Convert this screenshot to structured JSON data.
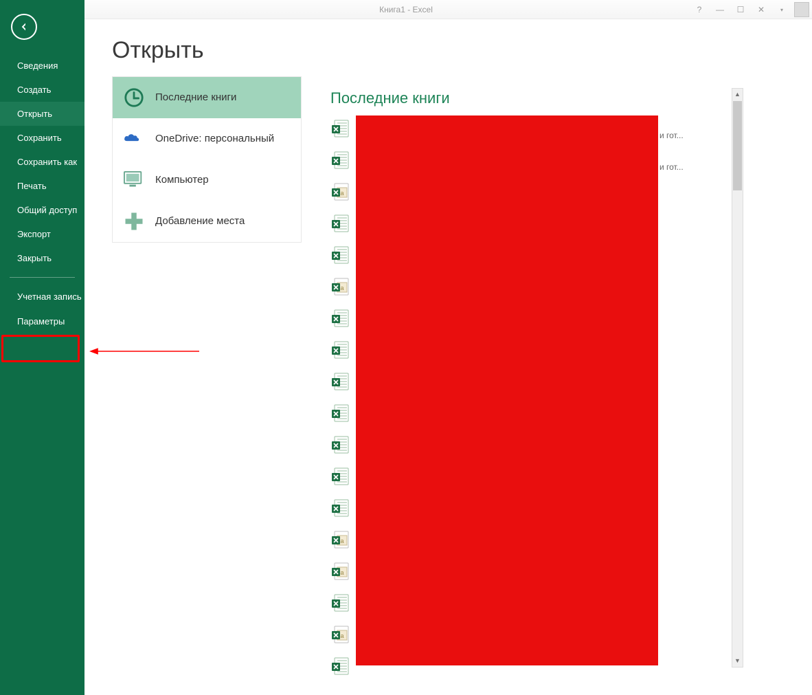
{
  "titlebar": {
    "title": "Книга1 - Excel"
  },
  "sidebar": {
    "items": [
      {
        "label": "Сведения"
      },
      {
        "label": "Создать"
      },
      {
        "label": "Открыть",
        "selected": true
      },
      {
        "label": "Сохранить"
      },
      {
        "label": "Сохранить как"
      },
      {
        "label": "Печать"
      },
      {
        "label": "Общий доступ"
      },
      {
        "label": "Экспорт"
      },
      {
        "label": "Закрыть"
      }
    ],
    "account_label": "Учетная запись",
    "options_label": "Параметры"
  },
  "page": {
    "title": "Открыть"
  },
  "places": [
    {
      "label": "Последние книги",
      "icon": "clock",
      "selected": true
    },
    {
      "label": "OneDrive: персональный",
      "icon": "onedrive"
    },
    {
      "label": "Компьютер",
      "icon": "computer"
    },
    {
      "label": "Добавление места",
      "icon": "addplace"
    }
  ],
  "recent": {
    "title": "Последние книги",
    "overflow_text_0": "и гот...",
    "overflow_text_1": "и гот...",
    "file_icons": [
      "xlsx",
      "xlsx",
      "xlsm",
      "xlsx",
      "xlsx",
      "xlsm",
      "xlsx",
      "xlsx",
      "xlsx",
      "xlsx",
      "xlsx",
      "xlsx",
      "xlsx",
      "xlsm",
      "xlsm",
      "xlsx",
      "xlsm",
      "xlsx"
    ]
  },
  "colors": {
    "sidebar": "#0e6d47",
    "place_selected": "#a0d4bb",
    "accent": "#1e8457",
    "redaction": "#e90e0e",
    "highlight": "#ff0000"
  }
}
